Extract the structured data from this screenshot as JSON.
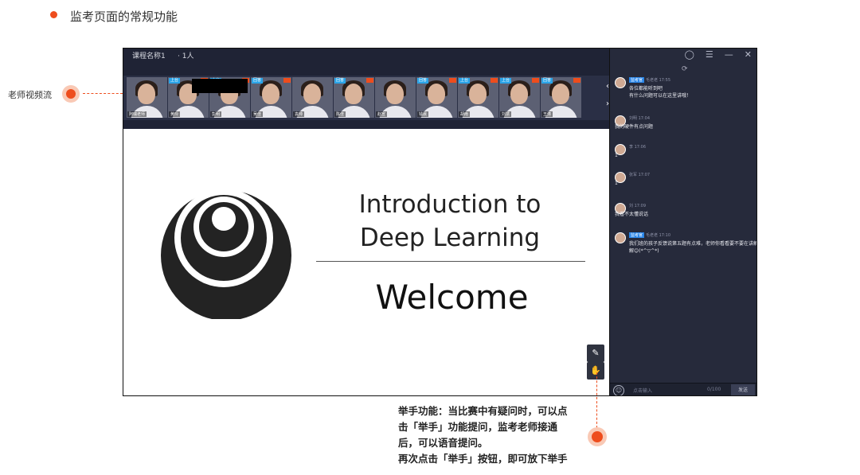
{
  "page": {
    "title": "监考页面的常规功能"
  },
  "callouts": {
    "left_label": "老师视频流",
    "raise_hand_lines": [
      "举手功能：当比赛中有疑问时，可以点",
      "击「举手」功能提问，监考老师接通",
      "后，可以语音提问。",
      "再次点击「举手」按钮，即可放下举手"
    ]
  },
  "window": {
    "course_name": "课程名称1",
    "participants": "· 1人",
    "controls": [
      "refresh-icon",
      "menu-icon",
      "minimize-icon",
      "close-icon"
    ]
  },
  "video_strip": {
    "teacher_name": "阿瑞老师",
    "tiles": [
      {
        "name": "阿瑞老师",
        "tag": ""
      },
      {
        "name": "黄玲",
        "tag": "上台"
      },
      {
        "name": "彭明",
        "tag": "上台"
      },
      {
        "name": "吴佳",
        "tag": "回答"
      },
      {
        "name": "袁帅",
        "tag": ""
      },
      {
        "name": "陈佳",
        "tag": "回答"
      },
      {
        "name": "赵宣",
        "tag": ""
      },
      {
        "name": "钱晨",
        "tag": "回答"
      },
      {
        "name": "胡雨",
        "tag": "上台"
      },
      {
        "name": "刘慧",
        "tag": "上台"
      },
      {
        "name": "王涛",
        "tag": "回答"
      }
    ]
  },
  "slide": {
    "title_line1": "Introduction to",
    "title_line2": "Deep Learning",
    "welcome": "Welcome"
  },
  "chat": {
    "messages": [
      {
        "user": "毛老老",
        "role": "监考官",
        "time": "17:55",
        "text": "各位都能听到吧\n有什么问题可以在这里讲哦！"
      },
      {
        "user": "刘明",
        "role": "",
        "time": "17:04",
        "text": "我的硬件有点问题"
      },
      {
        "user": "李",
        "role": "",
        "time": "17:06",
        "text": "1"
      },
      {
        "user": "张军",
        "role": "",
        "time": "17:07",
        "text": "1"
      },
      {
        "user": "刘",
        "role": "",
        "time": "17:09",
        "text": "我看不太懂说话"
      },
      {
        "user": "毛老老",
        "role": "监考官",
        "time": "17:10",
        "text": "我们班的孩子反馈说第五题有点难，老师你看看要不要在讲解一下讲解😊(*^▽^*)"
      }
    ],
    "input_placeholder": "点击输入",
    "counter": "0/100",
    "send_label": "发送"
  },
  "colors": {
    "accent": "#ee4d1d",
    "app_bg": "#1f2335",
    "chat_bg": "#262a3b",
    "role_badge": "#2a86e8"
  }
}
